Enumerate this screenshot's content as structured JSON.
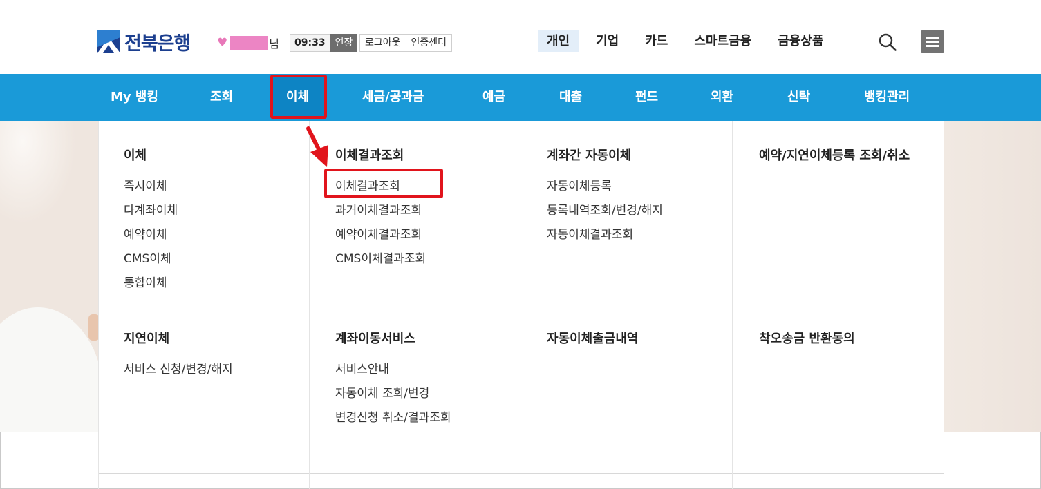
{
  "brand": {
    "name": "전북은행"
  },
  "user": {
    "suffix": "님"
  },
  "session": {
    "time": "09:33",
    "extend_label": "연장"
  },
  "auth": {
    "logout_label": "로그아웃",
    "cert_center_label": "인증센터"
  },
  "top_nav": [
    {
      "label": "개인",
      "active": true
    },
    {
      "label": "기업"
    },
    {
      "label": "카드"
    },
    {
      "label": "스마트금융"
    },
    {
      "label": "금융상품"
    }
  ],
  "icons": {
    "search": "search-icon",
    "menu": "hamburger-menu-icon",
    "heart": "heart-icon",
    "logo": "bank-logo-icon",
    "arrow": "red-arrow-icon"
  },
  "colors": {
    "nav_blue": "#1a9ad8",
    "highlight_red": "#e1141c",
    "brand_navy": "#1c3f8f"
  },
  "main_nav": [
    {
      "label": "My 뱅킹"
    },
    {
      "label": "조회"
    },
    {
      "label": "이체",
      "active": true
    },
    {
      "label": "세금/공과금"
    },
    {
      "label": "예금"
    },
    {
      "label": "대출"
    },
    {
      "label": "펀드"
    },
    {
      "label": "외환"
    },
    {
      "label": "신탁"
    },
    {
      "label": "뱅킹관리"
    }
  ],
  "menu": {
    "col1": {
      "sec1": {
        "title": "이체",
        "links": [
          "즉시이체",
          "다계좌이체",
          "예약이체",
          "CMS이체",
          "통합이체"
        ]
      },
      "sec2": {
        "title": "지연이체",
        "links": [
          "서비스 신청/변경/해지"
        ]
      }
    },
    "col2": {
      "sec1": {
        "title": "이체결과조회",
        "links": [
          "이체결과조회",
          "과거이체결과조회",
          "예약이체결과조회",
          "CMS이체결과조회"
        ]
      },
      "sec2": {
        "title": "계좌이동서비스",
        "links": [
          "서비스안내",
          "자동이체 조회/변경",
          "변경신청 취소/결과조회"
        ]
      }
    },
    "col3": {
      "sec1": {
        "title": "계좌간 자동이체",
        "links": [
          "자동이체등록",
          "등록내역조회/변경/해지",
          "자동이체결과조회"
        ]
      },
      "sec2": {
        "title": "자동이체출금내역",
        "links": []
      }
    },
    "col4": {
      "sec1": {
        "title": "예약/지연이체등록 조회/취소",
        "links": []
      },
      "sec2": {
        "title": "착오송금 반환동의",
        "links": []
      }
    }
  }
}
